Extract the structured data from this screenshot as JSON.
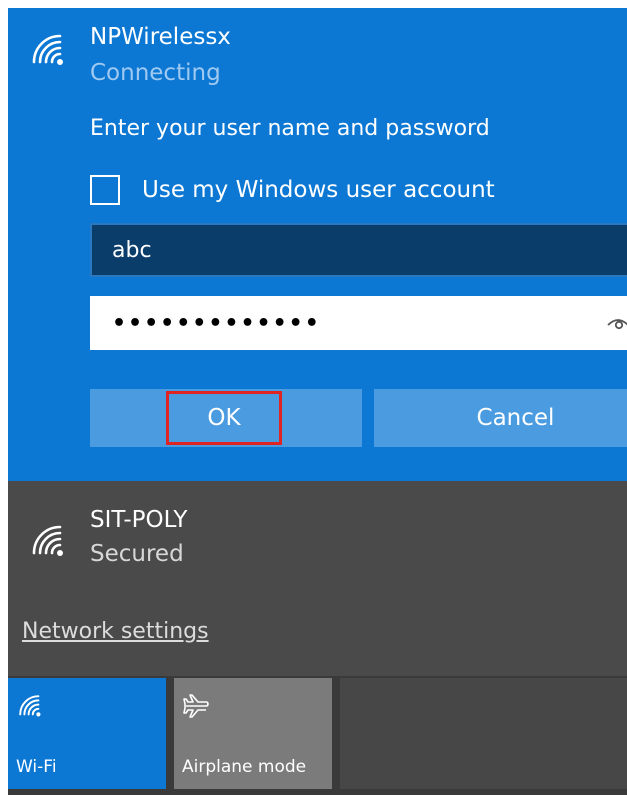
{
  "active_network": {
    "name": "NPWirelessx",
    "status": "Connecting",
    "prompt": "Enter your user name and password",
    "use_windows_account_label": "Use my Windows user account",
    "use_windows_account_checked": false,
    "username_value": "abc",
    "password_masked": "•••••••••••••",
    "ok_label": "OK",
    "cancel_label": "Cancel"
  },
  "other_networks": [
    {
      "name": "SIT-POLY",
      "status": "Secured"
    }
  ],
  "network_settings_label": "Network settings",
  "quick_actions": [
    {
      "label": "Wi-Fi",
      "icon": "wifi-icon",
      "active": true
    },
    {
      "label": "Airplane mode",
      "icon": "airplane-icon",
      "active": false
    }
  ],
  "colors": {
    "accent_blue": "#0c78d4",
    "dark_panel": "#4a4a4a",
    "highlight_red": "#e02424",
    "button_blue": "#4a9be0"
  }
}
